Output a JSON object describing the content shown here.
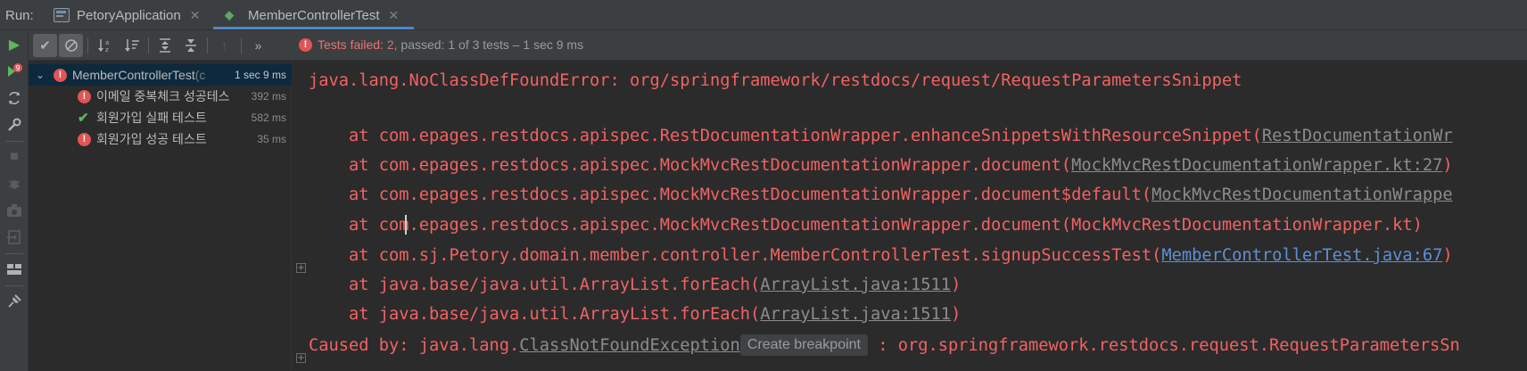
{
  "run_bar": {
    "label": "Run:",
    "tabs": [
      {
        "label": "PetoryApplication",
        "icon": "application-icon"
      },
      {
        "label": "MemberControllerTest",
        "icon": "test-class-icon",
        "active": true
      }
    ]
  },
  "toolbar": {
    "status": {
      "failed_label": "Tests failed:",
      "failed_count": "2",
      "passed_label": ", passed:",
      "passed_count": "1",
      "tail": "of 3 tests – 1 sec 9 ms"
    },
    "more": "»"
  },
  "tree": {
    "root": {
      "label": "MemberControllerTest",
      "suffix": " (c",
      "time": "1 sec 9 ms",
      "status": "failed"
    },
    "items": [
      {
        "label": "이메일 중복체크 성공테스",
        "time": "392 ms",
        "status": "failed"
      },
      {
        "label": "회원가입 실패 테스트",
        "time": "582 ms",
        "status": "passed"
      },
      {
        "label": "회원가입 성공 테스트",
        "time": "35 ms",
        "status": "failed"
      }
    ]
  },
  "console": {
    "error_line": "java.lang.NoClassDefFoundError: org/springframework/restdocs/request/RequestParametersSnippet",
    "stack": [
      {
        "prefix": "    at com.epages.restdocs.apispec.RestDocumentationWrapper.enhanceSnippetsWithResourceSnippet(",
        "link": "RestDocumentationWr",
        "link_style": "grey",
        "suffix": ""
      },
      {
        "prefix": "    at com.epages.restdocs.apispec.MockMvcRestDocumentationWrapper.document(",
        "link": "MockMvcRestDocumentationWrapper.kt:27",
        "link_style": "grey",
        "suffix": ")"
      },
      {
        "prefix": "    at com.epages.restdocs.apispec.MockMvcRestDocumentationWrapper.document$default(",
        "link": "MockMvcRestDocumentationWrappe",
        "link_style": "grey",
        "suffix": ""
      },
      {
        "prefix": "    at com.epages.restdocs.apispec.MockMvcRestDocumentationWrapper.document(MockMvcRestDocumentationWrapper.kt)",
        "link": "",
        "link_style": "none",
        "suffix": ""
      },
      {
        "prefix": "    at com.sj.Petory.domain.member.controller.MemberControllerTest.signupSuccessTest(",
        "link": "MemberControllerTest.java:67",
        "link_style": "blue",
        "suffix": ")"
      },
      {
        "prefix": "    at java.base/java.util.ArrayList.forEach(",
        "link": "ArrayList.java:1511",
        "link_style": "grey",
        "suffix": ")"
      },
      {
        "prefix": "    at java.base/java.util.ArrayList.forEach(",
        "link": "ArrayList.java:1511",
        "link_style": "grey",
        "suffix": ")"
      }
    ],
    "caused_by": {
      "prefix": "Caused by: java.lang.",
      "link": "ClassNotFoundException",
      "chip": "Create breakpoint",
      "suffix": " : org.springframework.restdocs.request.RequestParametersSn"
    },
    "colors": {
      "error": "#f36262",
      "link_grey": "#8c8c8c",
      "link_blue": "#5d8fd8"
    }
  }
}
